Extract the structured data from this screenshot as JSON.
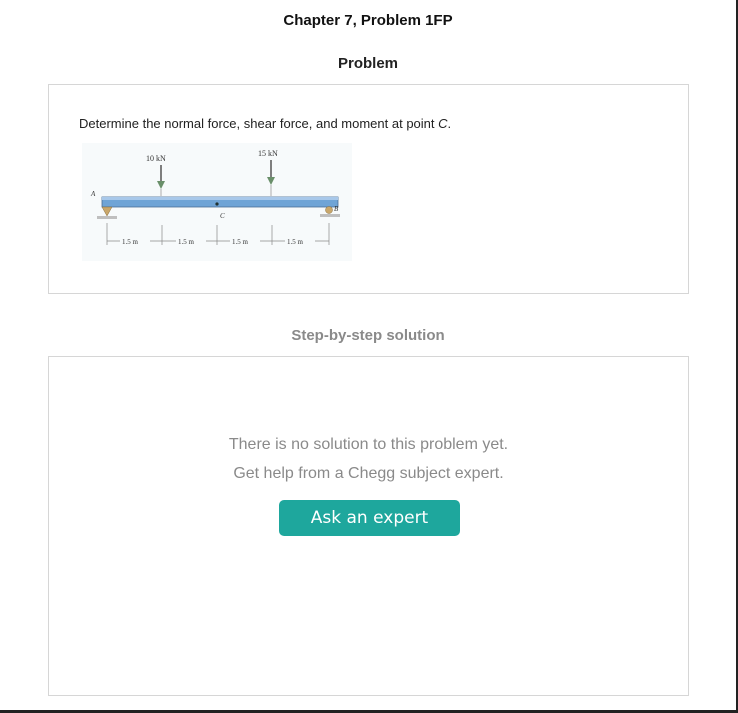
{
  "header": {
    "chapter_title": "Chapter 7, Problem 1FP",
    "problem_heading": "Problem"
  },
  "problem": {
    "text_prefix": "Determine the normal force, shear force, and moment at point ",
    "text_point": "C",
    "text_suffix": ".",
    "figure": {
      "load_left": "10 kN",
      "load_right": "15 kN",
      "support_left": "A",
      "support_right": "B",
      "point_label": "C",
      "dims": [
        "1.5 m",
        "1.5 m",
        "1.5 m",
        "1.5 m"
      ]
    }
  },
  "solution": {
    "heading": "Step-by-step solution",
    "no_solution_text": "There is no solution to this problem yet.",
    "help_text": "Get help from a Chegg subject expert.",
    "ask_button_label": "Ask an expert"
  },
  "colors": {
    "accent": "#1ea79d",
    "muted_text": "#8a8a8a",
    "card_border": "#d6d6d6"
  }
}
